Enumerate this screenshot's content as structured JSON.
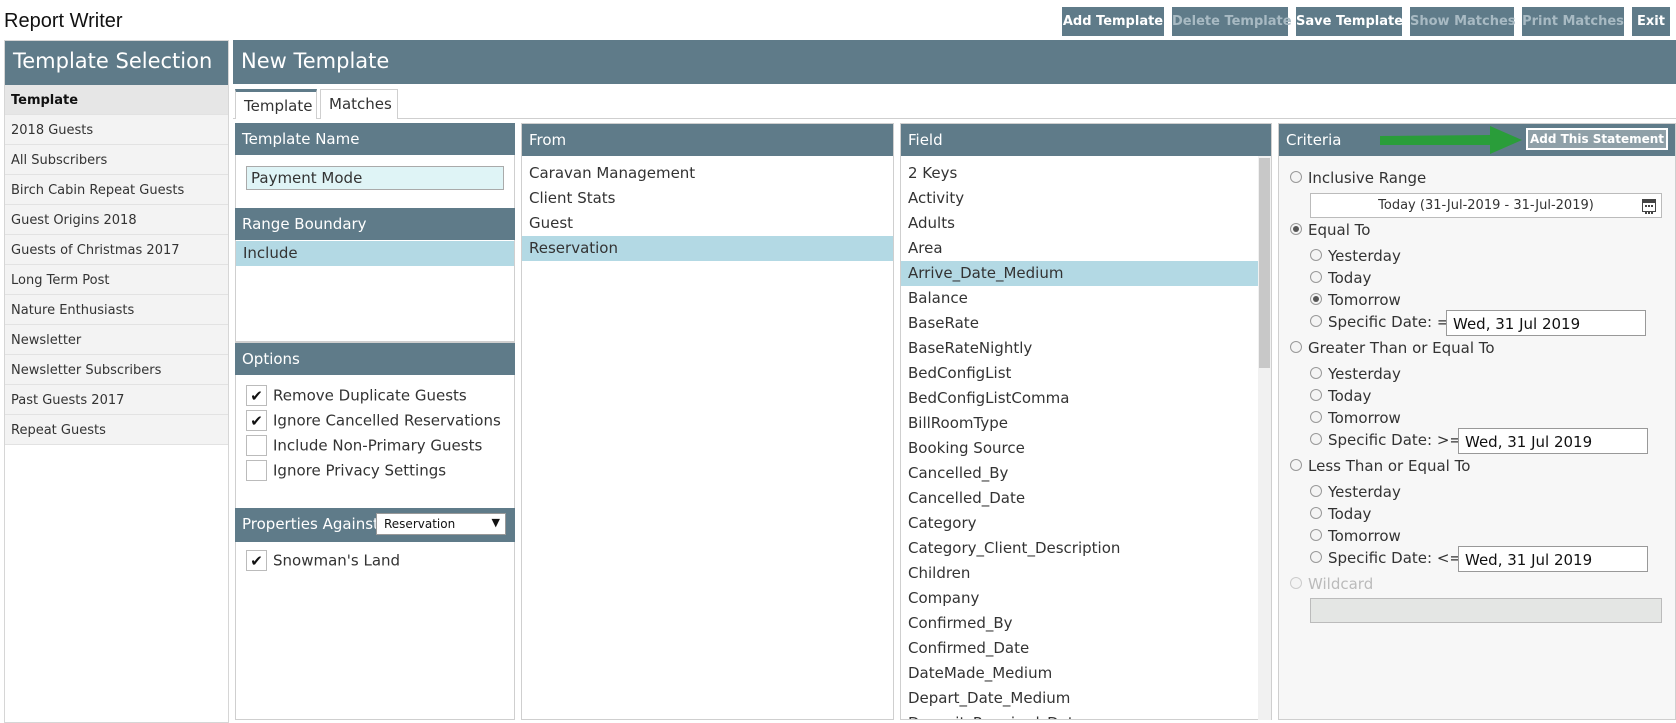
{
  "app_title": "Report Writer",
  "sidebar": {
    "title": "Template Selection",
    "items": [
      {
        "label": "Template"
      },
      {
        "label": "2018 Guests"
      },
      {
        "label": "All Subscribers"
      },
      {
        "label": "Birch Cabin Repeat Guests"
      },
      {
        "label": "Guest Origins 2018"
      },
      {
        "label": "Guests of Christmas 2017"
      },
      {
        "label": "Long Term Post"
      },
      {
        "label": "Nature Enthusiasts"
      },
      {
        "label": "Newsletter"
      },
      {
        "label": "Newsletter Subscribers"
      },
      {
        "label": "Past Guests 2017"
      },
      {
        "label": "Repeat Guests"
      }
    ]
  },
  "header": {
    "title": "New Template",
    "buttons": {
      "add_template": "Add Template",
      "delete_template": "Delete Template",
      "save_template": "Save Template",
      "show_matches": "Show Matches",
      "print_matches": "Print Matches",
      "exit": "Exit"
    }
  },
  "tabs": {
    "template": "Template",
    "matches": "Matches"
  },
  "template_name": {
    "header": "Template Name",
    "value": "Payment Mode"
  },
  "range_boundary": {
    "header": "Range Boundary",
    "items": [
      "Include"
    ]
  },
  "options": {
    "header": "Options",
    "items": [
      {
        "label": "Remove Duplicate Guests",
        "check": "✔"
      },
      {
        "label": "Ignore Cancelled Reservations",
        "check": "✔"
      },
      {
        "label": "Include Non-Primary Guests",
        "check": ""
      },
      {
        "label": "Ignore Privacy Settings",
        "check": ""
      }
    ]
  },
  "properties": {
    "header": "Properties Against",
    "select_value": "Reservation",
    "items": [
      {
        "label": "Snowman's Land",
        "check": "✔"
      }
    ]
  },
  "from": {
    "header": "From",
    "items": [
      "Caravan Management",
      "Client Stats",
      "Guest",
      "Reservation"
    ],
    "selected": "Reservation"
  },
  "field": {
    "header": "Field",
    "items": [
      "2 Keys",
      "Activity",
      "Adults",
      "Area",
      "Arrive_Date_Medium",
      "Balance",
      "BaseRate",
      "BaseRateNightly",
      "BedConfigList",
      "BedConfigListComma",
      "BillRoomType",
      "Booking Source",
      "Cancelled_By",
      "Cancelled_Date",
      "Category",
      "Category_Client_Description",
      "Children",
      "Company",
      "Confirmed_By",
      "Confirmed_Date",
      "DateMade_Medium",
      "Depart_Date_Medium",
      "Deposit_Required_Dat"
    ],
    "selected": "Arrive_Date_Medium"
  },
  "criteria": {
    "header": "Criteria",
    "add_button": "Add This Statement",
    "inclusive_range": "Inclusive Range",
    "range_value": "Today (31-Jul-2019 - 31-Jul-2019)",
    "equal_to": "Equal To",
    "greater_equal": "Greater Than or Equal To",
    "less_equal": "Less Than or Equal To",
    "wildcard": "Wildcard",
    "yesterday": "Yesterday",
    "today": "Today",
    "tomorrow": "Tomorrow",
    "specific_eq": "Specific Date: =",
    "specific_ge": "Specific Date: >=",
    "specific_le": "Specific Date: <=",
    "date_eq": "Wed, 31 Jul 2019",
    "date_ge": "Wed, 31 Jul 2019",
    "date_le": "Wed, 31 Jul 2019",
    "selected_mode": "Equal To",
    "selected_option": "Tomorrow"
  },
  "colors": {
    "header_bg": "#5f7b89",
    "selected_row": "#b3d9e4",
    "input_highlight": "#dff4f6",
    "arrow": "#2a9d3a"
  },
  "icons": [
    "calendar-icon",
    "chevron-down-icon",
    "check-icon",
    "green-arrow-icon"
  ]
}
